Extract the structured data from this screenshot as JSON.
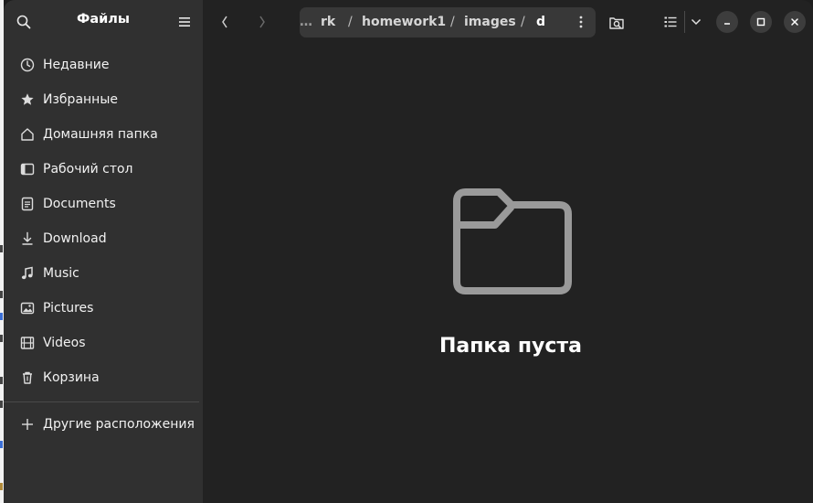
{
  "sidebar": {
    "title": "Файлы",
    "items": [
      {
        "label": "Недавние",
        "icon": "clock-icon"
      },
      {
        "label": "Избранные",
        "icon": "star-icon"
      },
      {
        "label": "Домашняя папка",
        "icon": "home-icon"
      },
      {
        "label": "Рабочий стол",
        "icon": "desktop-icon"
      },
      {
        "label": "Documents",
        "icon": "document-icon"
      },
      {
        "label": "Download",
        "icon": "download-icon"
      },
      {
        "label": "Music",
        "icon": "music-icon"
      },
      {
        "label": "Pictures",
        "icon": "picture-icon"
      },
      {
        "label": "Videos",
        "icon": "video-icon"
      },
      {
        "label": "Корзина",
        "icon": "trash-icon"
      }
    ],
    "other_locations": "Другие расположения"
  },
  "pathbar": {
    "ellipsis": "…",
    "segments": [
      "rk",
      "homework1",
      "images",
      "d"
    ],
    "separator": "/"
  },
  "empty_state": {
    "message": "Папка пуста"
  }
}
